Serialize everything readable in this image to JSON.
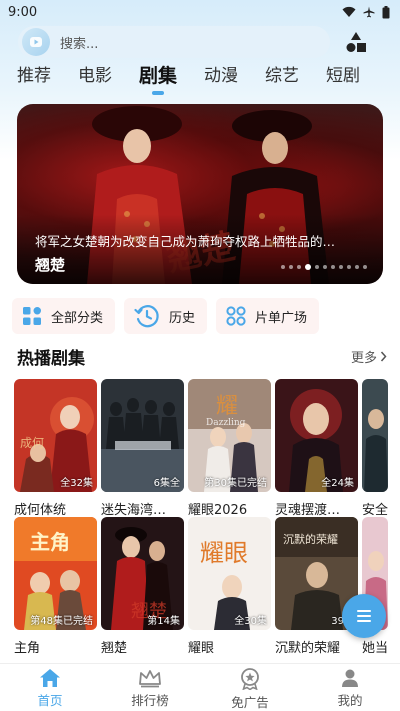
{
  "status_bar": {
    "time": "9:00"
  },
  "search": {
    "placeholder": "搜索..."
  },
  "tabs": [
    {
      "label": "推荐",
      "active": false
    },
    {
      "label": "电影",
      "active": false
    },
    {
      "label": "剧集",
      "active": true
    },
    {
      "label": "动漫",
      "active": false
    },
    {
      "label": "综艺",
      "active": false
    },
    {
      "label": "短剧",
      "active": false
    }
  ],
  "banner": {
    "description": "将军之女楚朝为改变自己成为萧珣夺权路上牺牲品的…",
    "title": "翘楚",
    "slide_count": 11,
    "active_slide": 3
  },
  "quick_actions": [
    {
      "label": "全部分类",
      "icon": "category-grid-icon"
    },
    {
      "label": "历史",
      "icon": "history-clock-icon"
    },
    {
      "label": "片单广场",
      "icon": "playlist-circles-icon"
    }
  ],
  "section": {
    "title": "热播剧集",
    "more": "更多"
  },
  "row1": [
    {
      "title": "成何体统",
      "badge": "全32集"
    },
    {
      "title": "迷失海湾…",
      "badge": "6集全"
    },
    {
      "title": "耀眼2026",
      "badge": "第30集已完结"
    },
    {
      "title": "灵魂摆渡…",
      "badge": "全24集"
    },
    {
      "title": "安全",
      "badge": ""
    }
  ],
  "row2": [
    {
      "title": "主角",
      "badge": "第48集已完结"
    },
    {
      "title": "翘楚",
      "badge": "第14集"
    },
    {
      "title": "耀眼",
      "badge": "全30集"
    },
    {
      "title": "沉默的荣耀",
      "badge": "39集"
    },
    {
      "title": "她当",
      "badge": ""
    }
  ],
  "poster_texts": {
    "zhujue": "主角",
    "yaoyan": "耀眼",
    "chenmo": "沉默的荣耀"
  },
  "bottom_nav": [
    {
      "label": "首页",
      "icon": "home-icon",
      "active": true
    },
    {
      "label": "排行榜",
      "icon": "crown-icon",
      "active": false
    },
    {
      "label": "免广告",
      "icon": "badge-star-icon",
      "active": false
    },
    {
      "label": "我的",
      "icon": "person-icon",
      "active": false
    }
  ],
  "colors": {
    "accent": "#4aa7e8",
    "quick_bg": "#fdf3f2",
    "search_bg": "#e4f1fa"
  }
}
